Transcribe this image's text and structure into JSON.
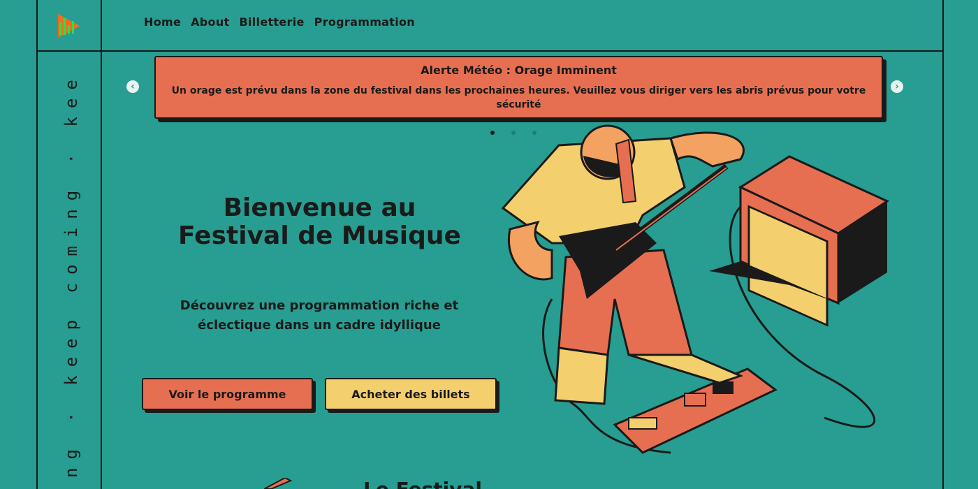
{
  "nav": {
    "logo_icon": "play-triangle-logo-icon",
    "items": [
      "Home",
      "About",
      "Billetterie",
      "Programmation"
    ]
  },
  "sidebar": {
    "marquee_text": "ng · keep coming · kee"
  },
  "alert": {
    "title": "Alerte Météo : Orage Imminent",
    "text": "Un orage est prévu dans la zone du festival dans les prochaines heures. Veuillez vous diriger vers les abris prévus pour votre sécurité",
    "prev_icon": "chevron-left-icon",
    "next_icon": "chevron-right-icon"
  },
  "hero": {
    "title": "Bienvenue au Festival de Musique",
    "subtitle": "Découvrez une programmation riche et éclectique dans un cadre idyllique",
    "btn_program": "Voir le programme",
    "btn_tickets": "Acheter des billets"
  },
  "next_section": {
    "title": "Le Festival"
  },
  "colors": {
    "background": "#279e91",
    "coral": "#e76f51",
    "yellow": "#f4cf6d",
    "ink": "#1a1a1a"
  }
}
